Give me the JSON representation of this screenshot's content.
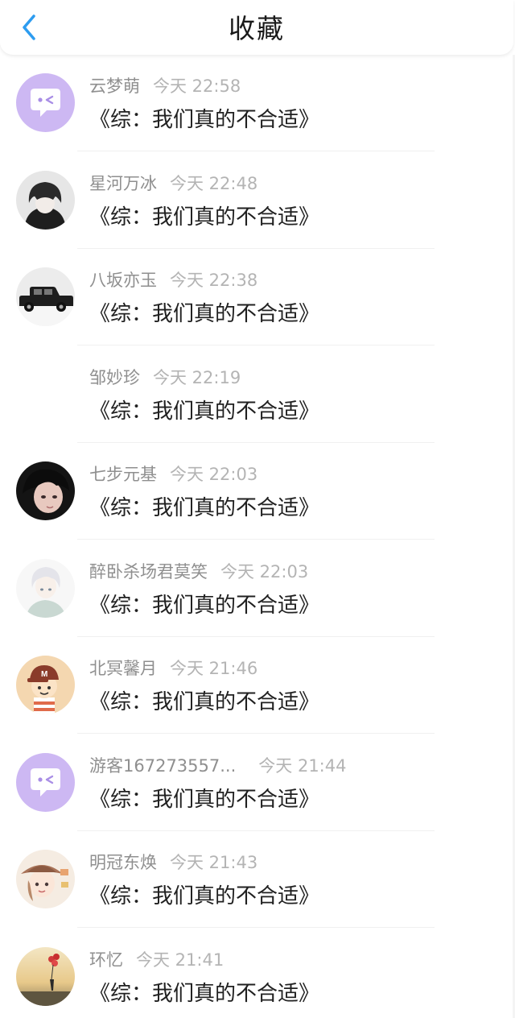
{
  "header": {
    "title": "收藏",
    "back_icon": "chevron-left-icon",
    "accent_color": "#2d9cf0"
  },
  "items": [
    {
      "name": "云梦萌",
      "time": "今天 22:58",
      "title": "《综：我们真的不合适》",
      "avatar": "chat-bubble-avatar"
    },
    {
      "name": "星河万冰",
      "time": "今天 22:48",
      "title": "《综：我们真的不合适》",
      "avatar": "anime-boy-dark-avatar"
    },
    {
      "name": "八坂亦玉",
      "time": "今天 22:38",
      "title": "《综：我们真的不合适》",
      "avatar": "vintage-car-avatar"
    },
    {
      "name": "邹妙珍",
      "time": "今天 22:19",
      "title": "《综：我们真的不合适》",
      "avatar": "blank-avatar"
    },
    {
      "name": "七步元基",
      "time": "今天 22:03",
      "title": "《综：我们真的不合适》",
      "avatar": "anime-face-avatar"
    },
    {
      "name": "醉卧杀场君莫笑",
      "time": "今天 22:03",
      "title": "《综：我们真的不合适》",
      "avatar": "anime-white-hair-avatar"
    },
    {
      "name": "北冥馨月",
      "time": "今天 21:46",
      "title": "《综：我们真的不合适》",
      "avatar": "cartoon-cap-avatar"
    },
    {
      "name": "游客167273557...",
      "time": "今天 21:44",
      "title": "《综：我们真的不合适》",
      "avatar": "chat-bubble-avatar"
    },
    {
      "name": "明冠东焕",
      "time": "今天 21:43",
      "title": "《综：我们真的不合适》",
      "avatar": "cartoon-girl-hat-avatar"
    },
    {
      "name": "环忆",
      "time": "今天 21:41",
      "title": "《综：我们真的不合适》",
      "avatar": "sunset-balloons-avatar"
    }
  ]
}
